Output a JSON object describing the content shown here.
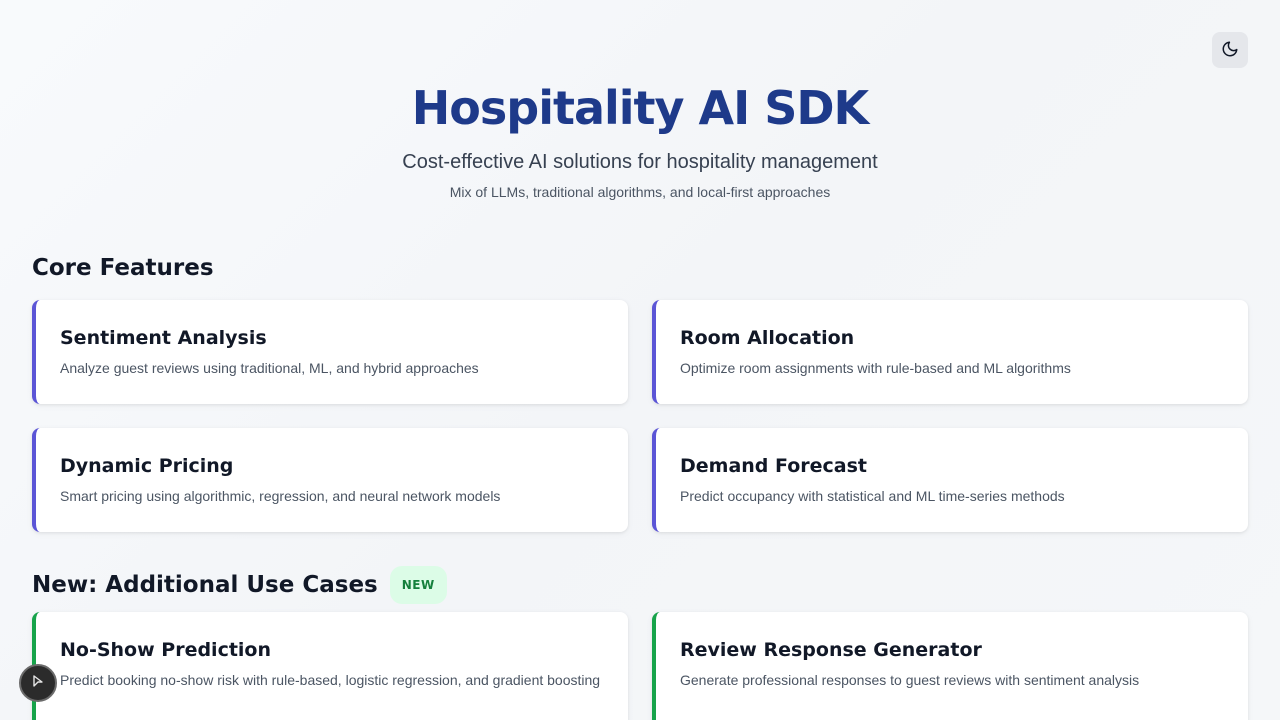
{
  "header": {
    "title": "Hospitality AI SDK",
    "subtitle": "Cost-effective AI solutions for hospitality management",
    "tagline": "Mix of LLMs, traditional algorithms, and local-first approaches"
  },
  "theme_toggle": {
    "icon": "moon-icon"
  },
  "core_features": {
    "title": "Core Features",
    "cards": [
      {
        "title": "Sentiment Analysis",
        "description": "Analyze guest reviews using traditional, ML, and hybrid approaches"
      },
      {
        "title": "Room Allocation",
        "description": "Optimize room assignments with rule-based and ML algorithms"
      },
      {
        "title": "Dynamic Pricing",
        "description": "Smart pricing using algorithmic, regression, and neural network models"
      },
      {
        "title": "Demand Forecast",
        "description": "Predict occupancy with statistical and ML time-series methods"
      }
    ]
  },
  "new_use_cases": {
    "title": "New: Additional Use Cases",
    "badge": "NEW",
    "cards": [
      {
        "title": "No-Show Prediction",
        "description": "Predict booking no-show risk with rule-based, logistic regression, and gradient boosting"
      },
      {
        "title": "Review Response Generator",
        "description": "Generate professional responses to guest reviews with sentiment analysis"
      }
    ]
  },
  "colors": {
    "title": "#1e3a8a",
    "core_accent": "#5b55d6",
    "new_accent": "#16a34a",
    "badge_bg": "#dcfce7",
    "badge_text": "#15803d"
  }
}
